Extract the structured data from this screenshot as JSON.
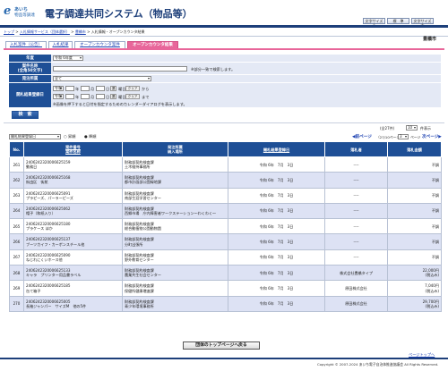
{
  "header": {
    "logo_mark": "e",
    "logo_line1": "あいち",
    "logo_line2": "物品等調達",
    "title": "電子調達共同システム（物品等）",
    "buttons": [
      "文字サイズ小",
      "標　準",
      "文字サイズ大"
    ]
  },
  "breadcrumb": {
    "items": [
      "トップ",
      "入札情報サービス（団体選択）",
      "豊橋市",
      "入札情報・オープンカウンタ結果"
    ],
    "separator": " > "
  },
  "tabs": [
    {
      "label": "入札案件（公告）",
      "active": false
    },
    {
      "label": "入札結果",
      "active": false
    },
    {
      "label": "オープンカウンタ案件",
      "active": false
    },
    {
      "label": "オープンカウンタ結果",
      "active": true
    }
  ],
  "organization": "豊橋市",
  "search_form": {
    "fields": {
      "year": {
        "label": "年度",
        "value": "令和 6年度"
      },
      "name": {
        "label": "案件名称\n(全角50文字)",
        "value": "",
        "hint": "※部分一致で検索します。"
      },
      "dept": {
        "label": "発注所属",
        "value": "全て"
      },
      "date": {
        "label": "開札結果登録日",
        "from": {
          "era": "令和",
          "year": "",
          "month": "",
          "day": ""
        },
        "to": {
          "era": "令和",
          "year": "",
          "month": "",
          "day": ""
        },
        "unit_year": "年",
        "unit_month": "月",
        "unit_day": "日",
        "cal_label": "選",
        "day_label": "曜日",
        "clear_label": "クリア",
        "from_suffix": "から",
        "to_suffix": "まで",
        "note": "※画像を押下すると日付を指定するためのカレンダーダイアログを表示します。"
      }
    },
    "search_button": "検　索"
  },
  "list_controls": {
    "count_text": "(全27件)",
    "page_size": "10",
    "per_page_label": "件表示",
    "sort_field": "開札結果登録日",
    "sort_asc": "昇順",
    "sort_desc": "降順",
    "prev": "前ページ",
    "page_info": "（27/10ページ）",
    "page_num": "3",
    "page_sep": "ページ",
    "next": "次ページ"
  },
  "table": {
    "headers": [
      "No.",
      "案件番号\n案件名称",
      "発注所属\n納入場所",
      "開札結果登録日",
      "落札者",
      "落札金額"
    ],
    "rows": [
      {
        "no": "261",
        "num": "2406242320006625159",
        "name": "動務日",
        "dept": "財務部契約検査課",
        "place": "土木維持事務所",
        "date": "令和 6年　7月　3日",
        "winner": "----",
        "amount": "不調",
        "tax": ""
      },
      {
        "no": "262",
        "num": "2406242320006625168",
        "name": "街由区　街航",
        "dept": "財務部契約検査課",
        "place": "都市計画部公園緑地課",
        "date": "令和 6年　7月　3日",
        "winner": "----",
        "amount": "不調",
        "tax": ""
      },
      {
        "no": "263",
        "num": "2406242320006625091",
        "name": "プラピーズ、パーラーピーズ",
        "dept": "財務部契約検査課",
        "place": "南部生涯学習センター",
        "date": "令和 6年　7月　3日",
        "winner": "----",
        "amount": "不調",
        "tax": ""
      },
      {
        "no": "264",
        "num": "2406242320006625062",
        "name": "帽子（和紙入り）",
        "dept": "財務部契約検査課",
        "place": "西郷市場　庁内障害者ワークステーション～わくわく～",
        "date": "令和 6年　7月　3日",
        "winner": "----",
        "amount": "不調",
        "tax": ""
      },
      {
        "no": "265",
        "num": "2406242320006625180",
        "name": "プラケース ほか",
        "dept": "財務部契約検査課",
        "place": "総合動植物公園動物園",
        "date": "令和 6年　7月　3日",
        "winner": "----",
        "amount": "不調",
        "tax": ""
      },
      {
        "no": "266",
        "num": "2406242320006625137",
        "name": "ブーツカイフ・カーボンスチール他",
        "dept": "財務部契約検査課",
        "place": "分町出張所",
        "date": "令和 6年　7月　3日",
        "winner": "----",
        "amount": "不調",
        "tax": ""
      },
      {
        "no": "267",
        "num": "2406242320006625090",
        "name": "ねじれにくいホース他",
        "dept": "財務部契約検査課",
        "place": "野外教育センター",
        "date": "令和 6年　7月　3日",
        "winner": "----",
        "amount": "不調",
        "tax": ""
      },
      {
        "no": "268",
        "num": "2406242320006625133",
        "name": "キャラ　プリンター用品書ラベル",
        "dept": "財務部契約検査課",
        "place": "農業共生社会センター",
        "date": "令和 6年　7月　3日",
        "winner": "株式会社豊橋タイプ",
        "amount": "22,000円",
        "tax": "(税込み)"
      },
      {
        "no": "269",
        "num": "2406242320006625185",
        "name": "缶て箱子",
        "dept": "財務部契約検査課",
        "place": "保健所健康増進課",
        "date": "令和 6年　7月　3日",
        "winner": "原田株式会社",
        "amount": "7,040円",
        "tax": "(税込み)"
      },
      {
        "no": "270",
        "num": "2406242320006625005",
        "name": "長袖ジャンパー　サイズM　他の5件",
        "dept": "財務部契約検査課",
        "place": "青少年環境事務所",
        "date": "令和 6年　7月　3日",
        "winner": "原田株式会社",
        "amount": "29,700円",
        "tax": "(税込み)"
      }
    ]
  },
  "footer": {
    "back_button": "団体のトップページへ戻る",
    "to_top": "ページトップへ",
    "copyright": "Copyright © 2007-2024 あいち電子自治体推進協議会 All Rights Reserved."
  },
  "colors": {
    "header_blue": "#1e4f96",
    "tab_active": "#e8669a",
    "row_alt": "#dde2f4"
  }
}
